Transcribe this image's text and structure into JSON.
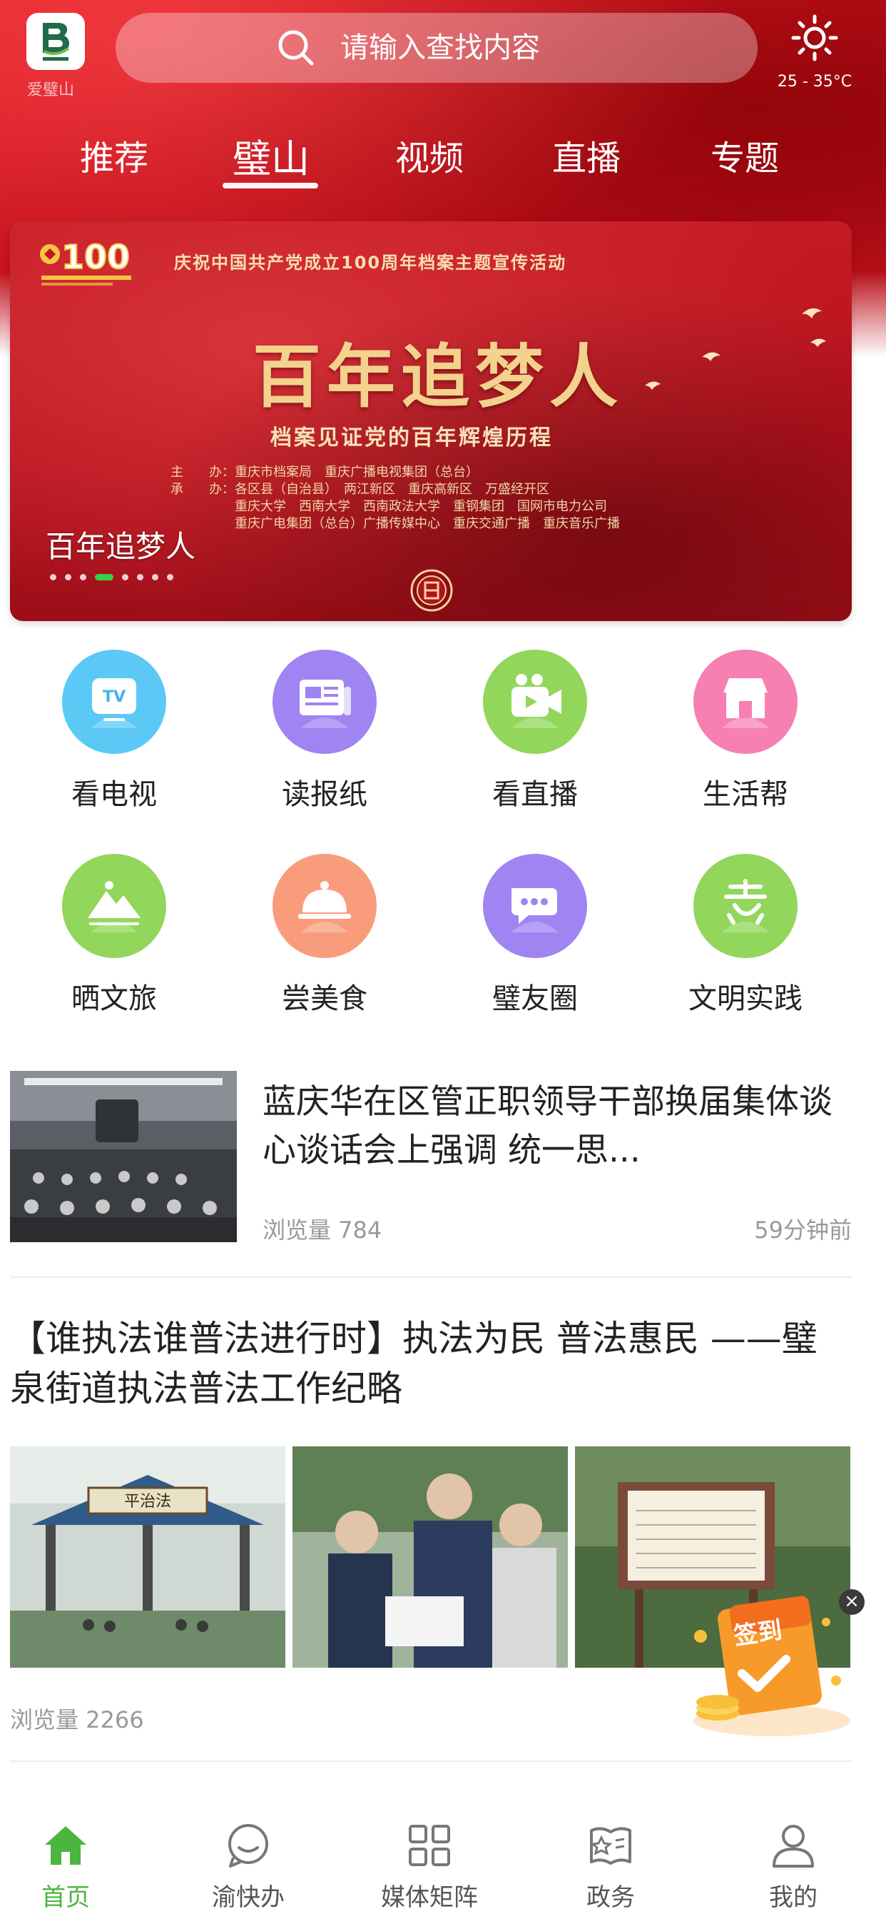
{
  "header": {
    "app_name": "爱璧山",
    "search_placeholder": "请输入查找内容",
    "weather_temp": "25 - 35°C",
    "weather_icon": "sun-icon",
    "tabs": [
      {
        "label": "推荐",
        "active": false
      },
      {
        "label": "璧山",
        "active": true
      },
      {
        "label": "视频",
        "active": false
      },
      {
        "label": "直播",
        "active": false
      },
      {
        "label": "专题",
        "active": false
      }
    ]
  },
  "banner": {
    "top_text": "庆祝中国共产党成立100周年档案主题宣传活动",
    "main_title": "百年追梦人",
    "sub_title": "档案见证党的百年辉煌历程",
    "org_lines": [
      "主　　办：重庆市档案局　重庆广播电视集团（总台）",
      "承　　办：各区县（自治县）　两江新区　重庆高新区　万盛经开区",
      "　　　　　重庆大学　西南大学　西南政法大学　重钢集团　国网市电力公司",
      "　　　　　重庆广电集团（总台）广播传媒中心　重庆交通广播　重庆音乐广播"
    ],
    "emblem_text": "100",
    "caption": "百年追梦人",
    "slide_count": 8,
    "active_slide": 3
  },
  "functions": [
    {
      "label": "看电视",
      "icon": "tv-icon",
      "color": "#4fc3f7"
    },
    {
      "label": "读报纸",
      "icon": "newspaper-icon",
      "color": "#9b7df0"
    },
    {
      "label": "看直播",
      "icon": "live-video-icon",
      "color": "#8fd65a"
    },
    {
      "label": "生活帮",
      "icon": "shop-icon",
      "color": "#f77fb0"
    },
    {
      "label": "晒文旅",
      "icon": "mountain-icon",
      "color": "#8fd65a"
    },
    {
      "label": "尝美食",
      "icon": "food-cloche-icon",
      "color": "#f79a7a"
    },
    {
      "label": "璧友圈",
      "icon": "chat-bubble-icon",
      "color": "#9b7df0"
    },
    {
      "label": "文明实践",
      "icon": "civilization-icon",
      "color": "#8fd65a"
    }
  ],
  "articles": [
    {
      "title": "蓝庆华在区管正职领导干部换届集体谈心谈话会上强调 统一思...",
      "views": "浏览量 784",
      "time": "59分钟前"
    },
    {
      "title": "【谁执法谁普法进行时】执法为民 普法惠民 ——璧泉街道执法普法工作纪略",
      "views": "浏览量 2266",
      "image_text": "平治法"
    }
  ],
  "floating": {
    "signin_label": "签到",
    "close_label": "×"
  },
  "bottom_nav": [
    {
      "label": "首页",
      "icon": "home-icon",
      "active": true
    },
    {
      "label": "渝快办",
      "icon": "chat-circle-icon",
      "active": false
    },
    {
      "label": "媒体矩阵",
      "icon": "grid-icon",
      "active": false
    },
    {
      "label": "政务",
      "icon": "gov-book-icon",
      "active": false
    },
    {
      "label": "我的",
      "icon": "user-icon",
      "active": false
    }
  ],
  "colors": {
    "brand_red": "#c41520",
    "active_green": "#4bb53e",
    "muted_text": "#999999"
  }
}
